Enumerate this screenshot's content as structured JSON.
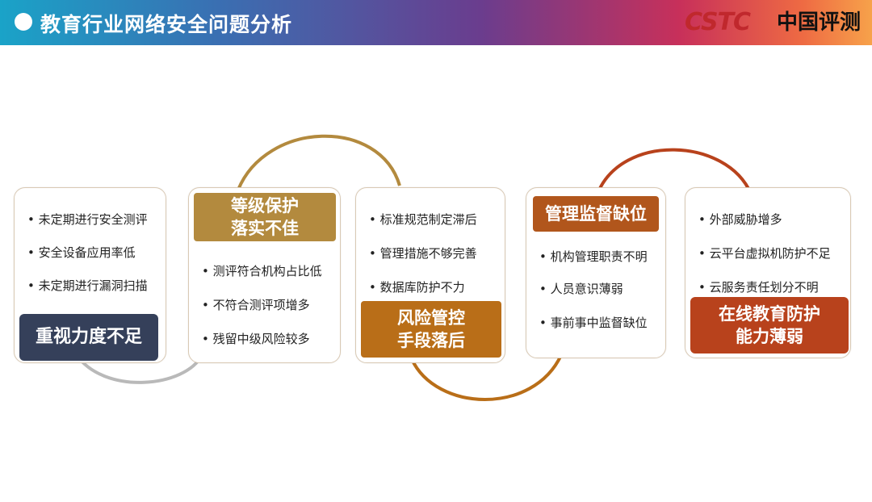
{
  "header": {
    "title": "教育行业网络安全问题分析"
  },
  "logo": {
    "mark": "CSTC",
    "text": "中国评测"
  },
  "colors": {
    "dark_slate": "#35405a",
    "gold": "#b38a3e",
    "amber": "#b96e18",
    "brown_orange": "#b1561c",
    "red_orange": "#b8421c"
  },
  "cards": [
    {
      "label": "重视力度不足",
      "items": [
        "未定期进行安全测评",
        "安全设备应用率低",
        "未定期进行漏洞扫描"
      ]
    },
    {
      "label": "等级保护\n落实不佳",
      "items": [
        "测评符合机构占比低",
        "不符合测评项增多",
        "残留中级风险较多"
      ]
    },
    {
      "label": "风险管控\n手段落后",
      "items": [
        "标准规范制定滞后",
        "管理措施不够完善",
        "数据库防护不力"
      ]
    },
    {
      "label": "管理监督缺位",
      "items": [
        "机构管理职责不明",
        "人员意识薄弱",
        "事前事中监督缺位"
      ]
    },
    {
      "label": "在线教育防护\n能力薄弱",
      "items": [
        "外部威胁增多",
        "云平台虚拟机防护不足",
        "云服务责任划分不明"
      ]
    }
  ]
}
